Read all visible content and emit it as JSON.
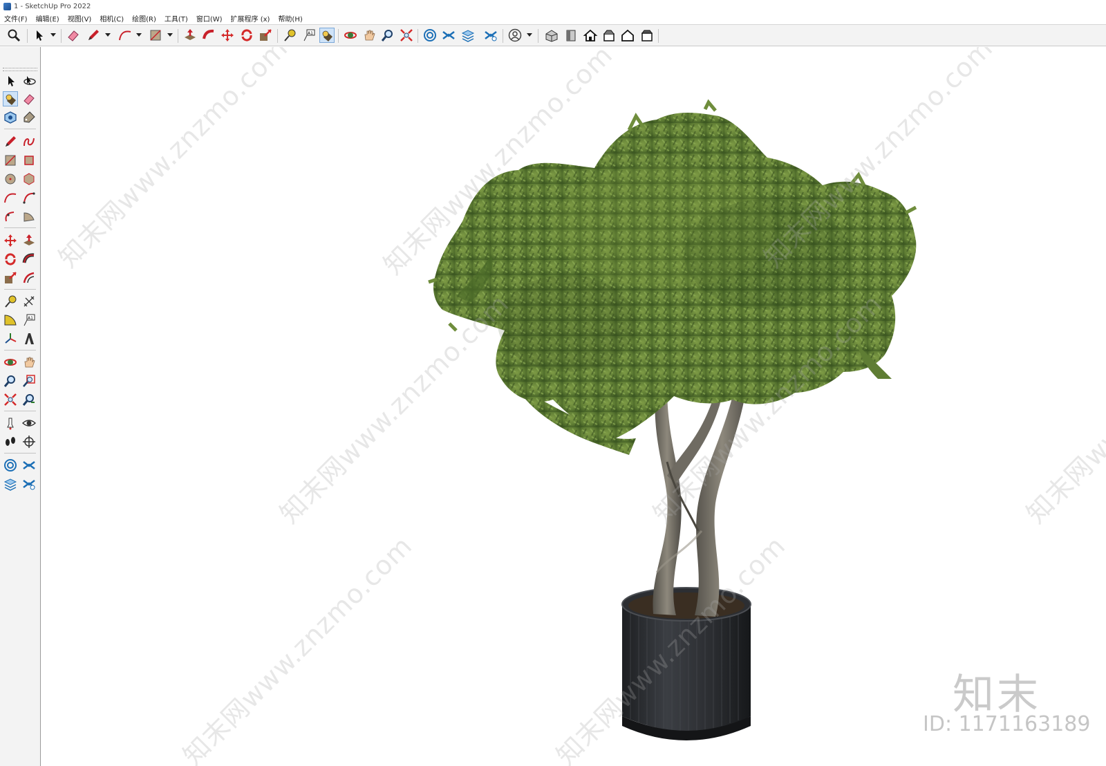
{
  "window": {
    "title": "1 - SketchUp Pro 2022"
  },
  "menu": [
    "文件(F)",
    "编辑(E)",
    "视图(V)",
    "相机(C)",
    "绘图(R)",
    "工具(T)",
    "窗口(W)",
    "扩展程序 (x)",
    "帮助(H)"
  ],
  "toolbar": {
    "icons": [
      "zoom-extents-icon",
      "select-icon",
      "eraser-icon",
      "pencil-icon",
      "arc-icon",
      "rectangle-icon",
      "push-pull-icon",
      "follow-me-icon",
      "move-icon",
      "rotate-icon",
      "scale-icon",
      "tape-measure-icon",
      "text-icon",
      "paint-bucket-icon",
      "orbit-icon",
      "pan-icon",
      "zoom-icon",
      "zoom-window-icon",
      "sandbox-from-contours-icon",
      "sandbox-smoove-icon",
      "sandbox-stamp-icon",
      "sandbox-flip-edge-icon",
      "account-icon",
      "iso-view-icon",
      "front-view-icon",
      "home-view-icon",
      "top-view-icon",
      "house-view-icon",
      "back-view-icon"
    ],
    "active": "paint-bucket-icon"
  },
  "sidebar": {
    "icons": [
      "select-icon",
      "orbit-3d-icon",
      "paint-bucket-icon",
      "eraser-icon",
      "component-icon",
      "tag-icon",
      "pencil-icon",
      "freehand-icon",
      "rectangle-icon",
      "rotated-rectangle-icon",
      "circle-icon",
      "polygon-icon",
      "arc-icon",
      "two-point-arc-icon",
      "three-point-arc-icon",
      "pie-icon",
      "move-icon",
      "push-pull-icon",
      "rotate-icon",
      "follow-me-icon",
      "scale-icon",
      "offset-icon",
      "tape-measure-icon",
      "dimension-icon",
      "protractor-icon",
      "text-icon",
      "axes-icon",
      "3d-text-icon",
      "orbit-icon",
      "pan-icon",
      "zoom-icon",
      "zoom-window-icon",
      "zoom-extents-icon",
      "previous-view-icon",
      "position-camera-icon",
      "look-around-icon",
      "walk-icon",
      "section-plane-icon",
      "sandbox-contours-icon",
      "sandbox-scratch-icon",
      "sandbox-drape-icon",
      "sandbox-add-detail-icon"
    ],
    "active": "paint-bucket-icon"
  },
  "scene": {
    "object": "potted-tree",
    "foliage_color": "#5f7d34",
    "trunk_color": "#77736a",
    "pot_color": "#2b2d31"
  },
  "watermark": {
    "text": "知末网www.znzmo.com",
    "logo": "知末",
    "id": "ID: 1171163189"
  }
}
